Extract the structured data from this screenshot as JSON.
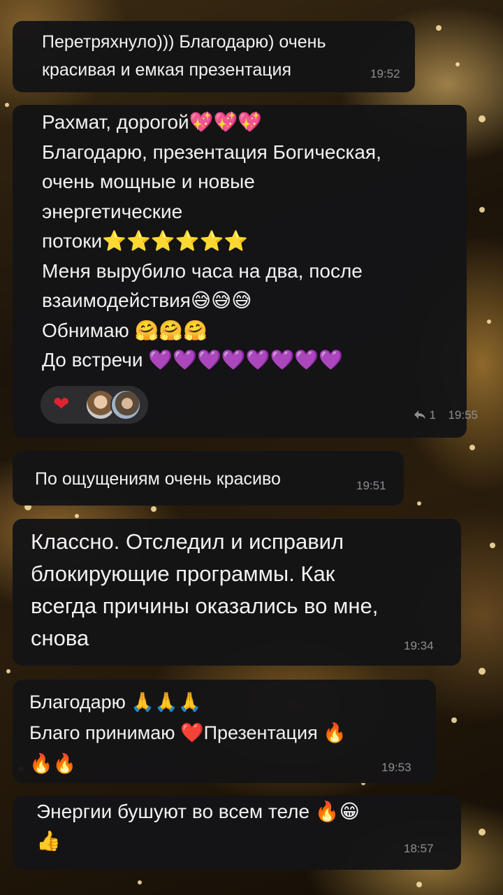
{
  "messages": [
    {
      "id": "m1",
      "text": "Перетряхнуло))) Благодарю) очень\nкрасивая и емкая презентация",
      "time": "19:52"
    },
    {
      "id": "m2",
      "lines": [
        "Рахмат, дорогой💖💖💖",
        "Благодарю, презентация Богическая,",
        "очень мощные и новые",
        "энергетические",
        "потоки⭐⭐⭐⭐⭐⭐",
        "Меня вырубило часа на два, после",
        "взаимодействия😅😅😅",
        "Обнимаю 🤗🤗🤗",
        "До встречи 💜💜💜💜💜💜💜💜"
      ],
      "reaction_emoji": "❤",
      "reply_count": "1",
      "time": "19:55"
    },
    {
      "id": "m3",
      "text": "По ощущениям очень красиво",
      "time": "19:51"
    },
    {
      "id": "m4",
      "text": "Классно. Отследил и исправил\nблокирующие программы. Как\nвсегда причины оказались во мне,\nснова",
      "time": "19:34"
    },
    {
      "id": "m5",
      "text": "Благодарю 🙏🙏🙏\nБлаго принимаю ❤️Презентация 🔥\n🔥🔥",
      "time": "19:53"
    },
    {
      "id": "m6",
      "text": "Энергии бушуют во всем теле 🔥😁\n👍",
      "time": "18:57"
    }
  ],
  "colors": {
    "bubble": "#141416",
    "text": "#f2f2f2",
    "timestamp": "#8e8e93",
    "reaction_pill": "#2d2d30",
    "heart": "#e0232f"
  },
  "icons": {
    "reply": "reply-arrow-icon"
  }
}
